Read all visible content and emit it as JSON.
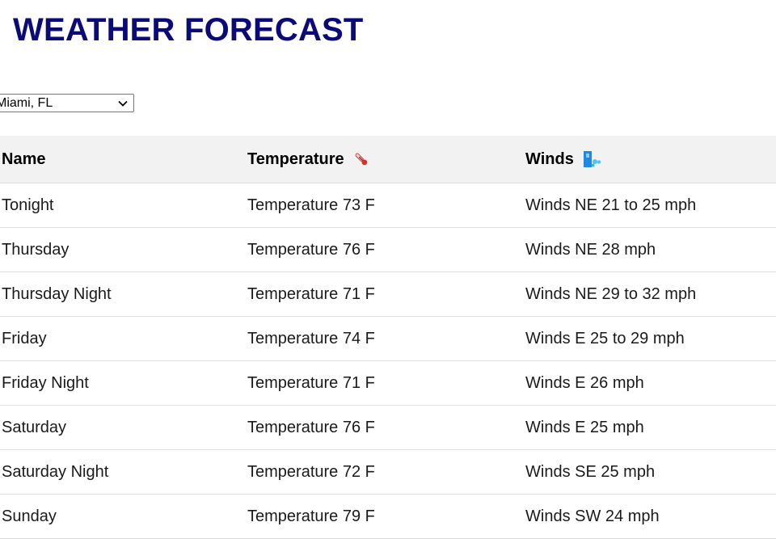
{
  "page": {
    "title": "WEATHER FORECAST"
  },
  "location_select": {
    "selected": "Miami, FL",
    "icon": "chevron-down-icon"
  },
  "table": {
    "headers": {
      "name": "Name",
      "temperature": "Temperature",
      "temperature_icon": "thermometer-icon",
      "winds": "Winds",
      "winds_icon": "wind-icon"
    },
    "rows": [
      {
        "name": "Tonight",
        "temperature": "Temperature 73 F",
        "winds": "Winds NE 21 to 25 mph"
      },
      {
        "name": "Thursday",
        "temperature": "Temperature 76 F",
        "winds": "Winds NE 28 mph"
      },
      {
        "name": "Thursday Night",
        "temperature": "Temperature 71 F",
        "winds": "Winds NE 29 to 32 mph"
      },
      {
        "name": "Friday",
        "temperature": "Temperature 74 F",
        "winds": "Winds E 25 to 29 mph"
      },
      {
        "name": "Friday Night",
        "temperature": "Temperature 71 F",
        "winds": "Winds E 26 mph"
      },
      {
        "name": "Saturday",
        "temperature": "Temperature 76 F",
        "winds": "Winds E 25 mph"
      },
      {
        "name": "Saturday Night",
        "temperature": "Temperature 72 F",
        "winds": "Winds SE 25 mph"
      },
      {
        "name": "Sunday",
        "temperature": "Temperature 79 F",
        "winds": "Winds SW 24 mph"
      }
    ]
  },
  "colors": {
    "title": "#0a0a7a",
    "header_bg": "#f2f2f2",
    "row_border": "#dddddd",
    "thermometer": "#d9302c",
    "wind_primary": "#1e88e5",
    "wind_secondary": "#4fc3f7"
  }
}
